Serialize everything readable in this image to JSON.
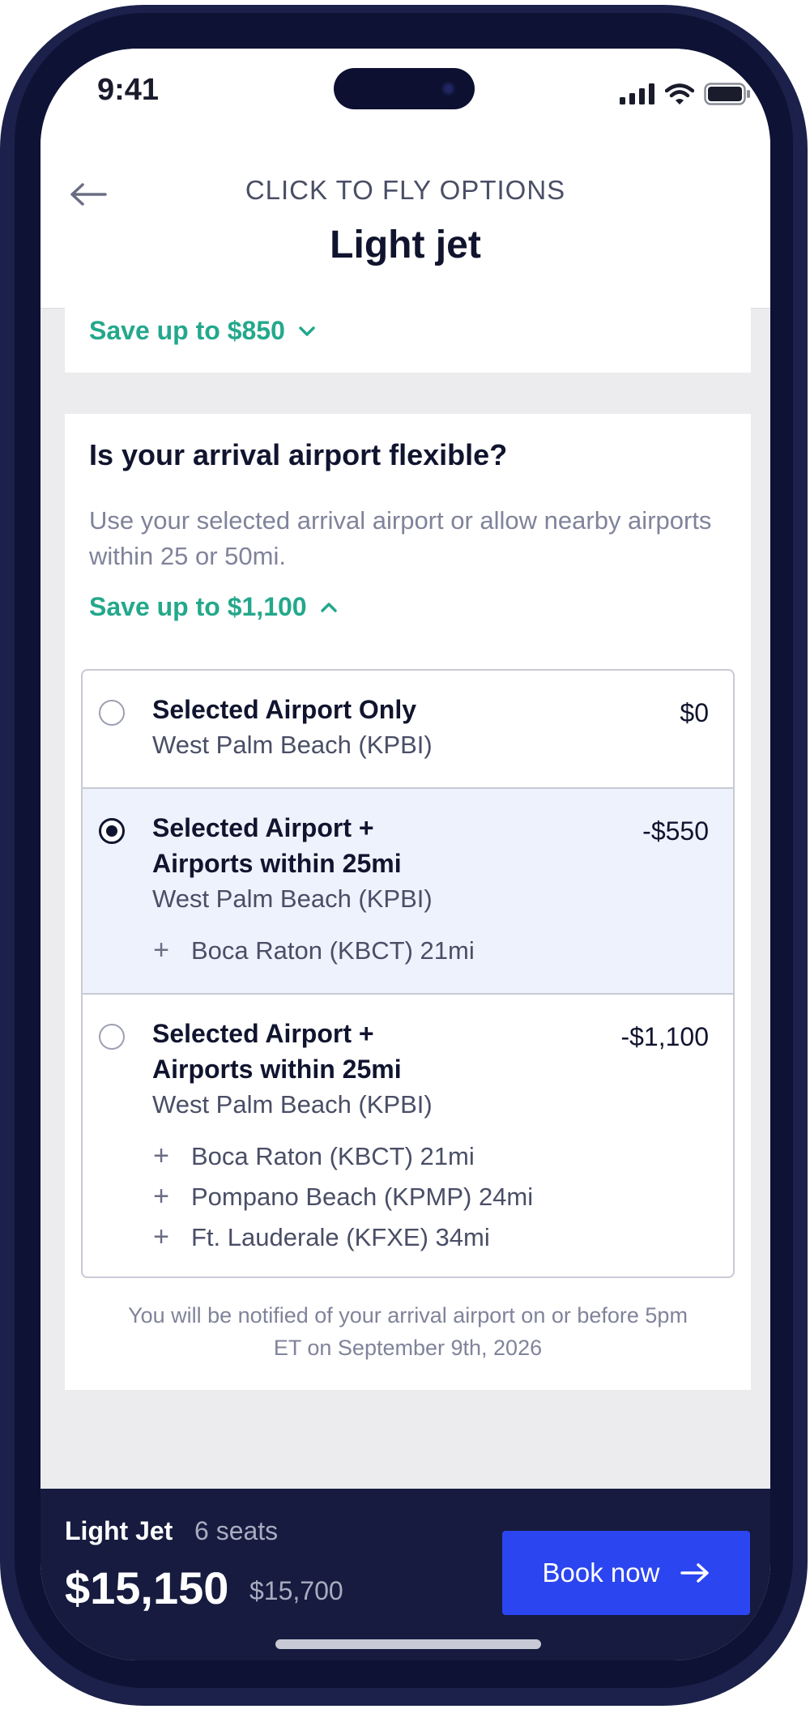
{
  "status": {
    "time": "9:41"
  },
  "header": {
    "kicker": "CLICK TO FLY OPTIONS",
    "title": "Light jet"
  },
  "prev_card": {
    "save_label": "Save up to $850"
  },
  "arrival": {
    "title": "Is your arrival airport flexible?",
    "description": "Use your selected arrival airport or allow nearby airports within 25 or 50mi.",
    "save_label": "Save up to $1,100",
    "options": [
      {
        "title": "Selected Airport Only",
        "subtitle": "West Palm Beach (KPBI)",
        "price": "$0",
        "selected": false,
        "extras": []
      },
      {
        "title_line1": "Selected Airport +",
        "title_line2": "Airports within 25mi",
        "subtitle": "West Palm Beach (KPBI)",
        "price": "-$550",
        "selected": true,
        "extras": [
          "Boca Raton (KBCT) 21mi"
        ]
      },
      {
        "title_line1": "Selected Airport +",
        "title_line2": "Airports within 25mi",
        "subtitle": "West Palm Beach (KPBI)",
        "price": "-$1,100",
        "selected": false,
        "extras": [
          "Boca Raton (KBCT) 21mi",
          "Pompano Beach (KPMP) 24mi",
          "Ft. Lauderale (KFXE) 34mi"
        ]
      }
    ],
    "note": "You will be notified of your arrival airport on or before 5pm ET on September 9th, 2026"
  },
  "footer": {
    "aircraft": "Light Jet",
    "seats": "6 seats",
    "price": "$15,150",
    "old_price": "$15,700",
    "book_label": "Book now"
  },
  "colors": {
    "accent_green": "#24a88c",
    "book_blue": "#2b45f0",
    "navy": "#161b3f"
  }
}
